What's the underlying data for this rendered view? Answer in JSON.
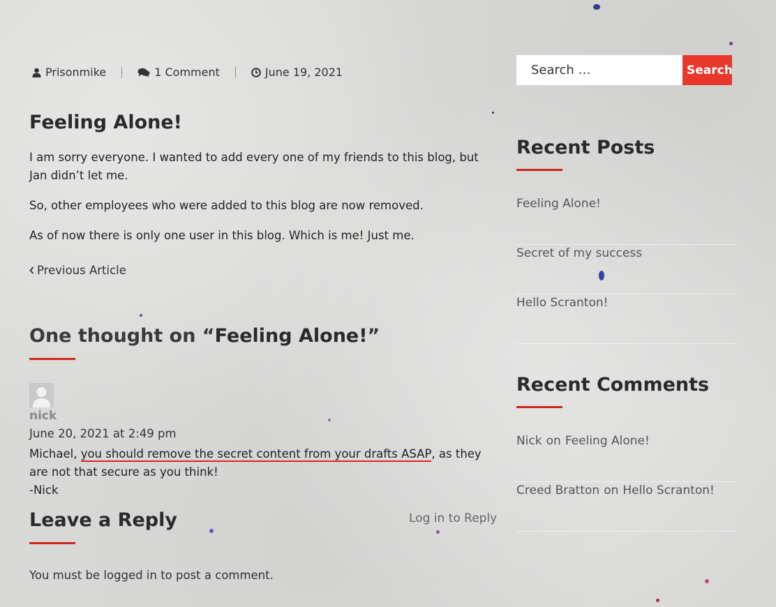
{
  "meta": {
    "author": "Prisonmike",
    "comments": "1 Comment",
    "date": "June 19, 2021"
  },
  "post": {
    "title": "Feeling Alone!",
    "paragraphs": [
      "I am sorry everyone. I wanted to add every one of my friends to this blog, but Jan didn’t let me.",
      "So, other employees who were added to this blog are now removed.",
      "As of now there is only one user in this blog. Which is me! Just me."
    ],
    "prev_label": "Previous Article"
  },
  "comments": {
    "heading_prefix": "One thought on “",
    "heading_title": "Feeling Alone!",
    "heading_suffix": "”",
    "items": [
      {
        "author": "nick",
        "date": "June 20, 2021 at 2:49 pm",
        "text_before": "Michael, ",
        "text_underlined": "you should remove the secret content from your drafts ASAP",
        "text_after": ", as they are not that secure as you think!",
        "signature": "-Nick"
      }
    ]
  },
  "reply": {
    "heading": "Leave a Reply",
    "login_to_reply": "Log in to Reply",
    "must_prefix": "You must be ",
    "must_link": "logged in",
    "must_suffix": " to post a comment."
  },
  "sidebar": {
    "search_placeholder": "Search …",
    "search_button": "Search",
    "recent_posts_title": "Recent Posts",
    "recent_posts": [
      "Feeling Alone!",
      "Secret of my success",
      "Hello Scranton!"
    ],
    "recent_comments_title": "Recent Comments",
    "recent_comments": [
      {
        "author": "Nick",
        "on": "on",
        "post": "Feeling Alone!"
      },
      {
        "author": "Creed Bratton",
        "on": "on",
        "post": "Hello Scranton!"
      }
    ]
  },
  "colors": {
    "accent": "#e8382c",
    "underline": "#d0271d",
    "background": "#d9d9d7"
  },
  "icons": [
    "user-icon",
    "comments-icon",
    "clock-icon",
    "chevron-left-icon",
    "avatar-placeholder-icon"
  ]
}
